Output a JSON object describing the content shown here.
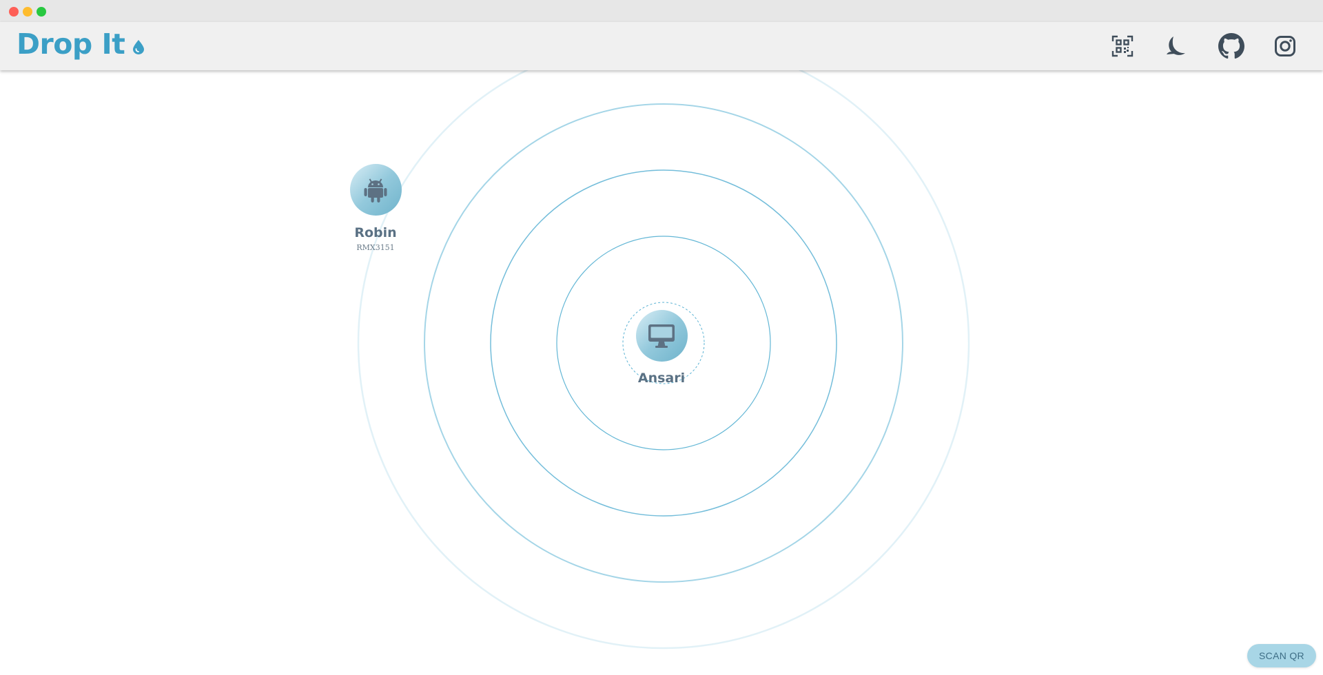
{
  "header": {
    "brand": "Drop It",
    "brand_color": "#3b9fc6",
    "actions": [
      {
        "icon": "qr-code-icon"
      },
      {
        "icon": "moon-icon"
      },
      {
        "icon": "github-icon"
      },
      {
        "icon": "instagram-icon"
      }
    ]
  },
  "devices": {
    "self": {
      "name": "Ansari",
      "icon": "desktop-icon"
    },
    "peers": [
      {
        "name": "Robin",
        "model": "RMX3151",
        "icon": "android-icon"
      }
    ]
  },
  "footer": {
    "scan_button": "SCAN QR"
  },
  "colors": {
    "accent": "#3b9fc6",
    "ring": "#5ab2d3",
    "avatar_gradient_start": "#d8edf5",
    "avatar_gradient_end": "#6fb3cb",
    "scan_button_bg": "#a8d6e6"
  }
}
